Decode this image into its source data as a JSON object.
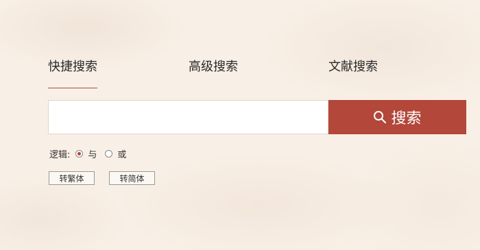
{
  "tabs": [
    {
      "label": "快捷搜索",
      "active": true
    },
    {
      "label": "高级搜索",
      "active": false
    },
    {
      "label": "文献搜索",
      "active": false
    }
  ],
  "search": {
    "placeholder": "",
    "value": "",
    "button_label": "搜索",
    "button_icon": "search-icon"
  },
  "logic": {
    "label": "逻辑:",
    "options": [
      {
        "label": "与",
        "selected": true
      },
      {
        "label": "或",
        "selected": false
      }
    ]
  },
  "convert": {
    "traditional_label": "转繁体",
    "simplified_label": "转简体"
  },
  "colors": {
    "accent": "#b2473a",
    "background": "#f8efe6"
  }
}
